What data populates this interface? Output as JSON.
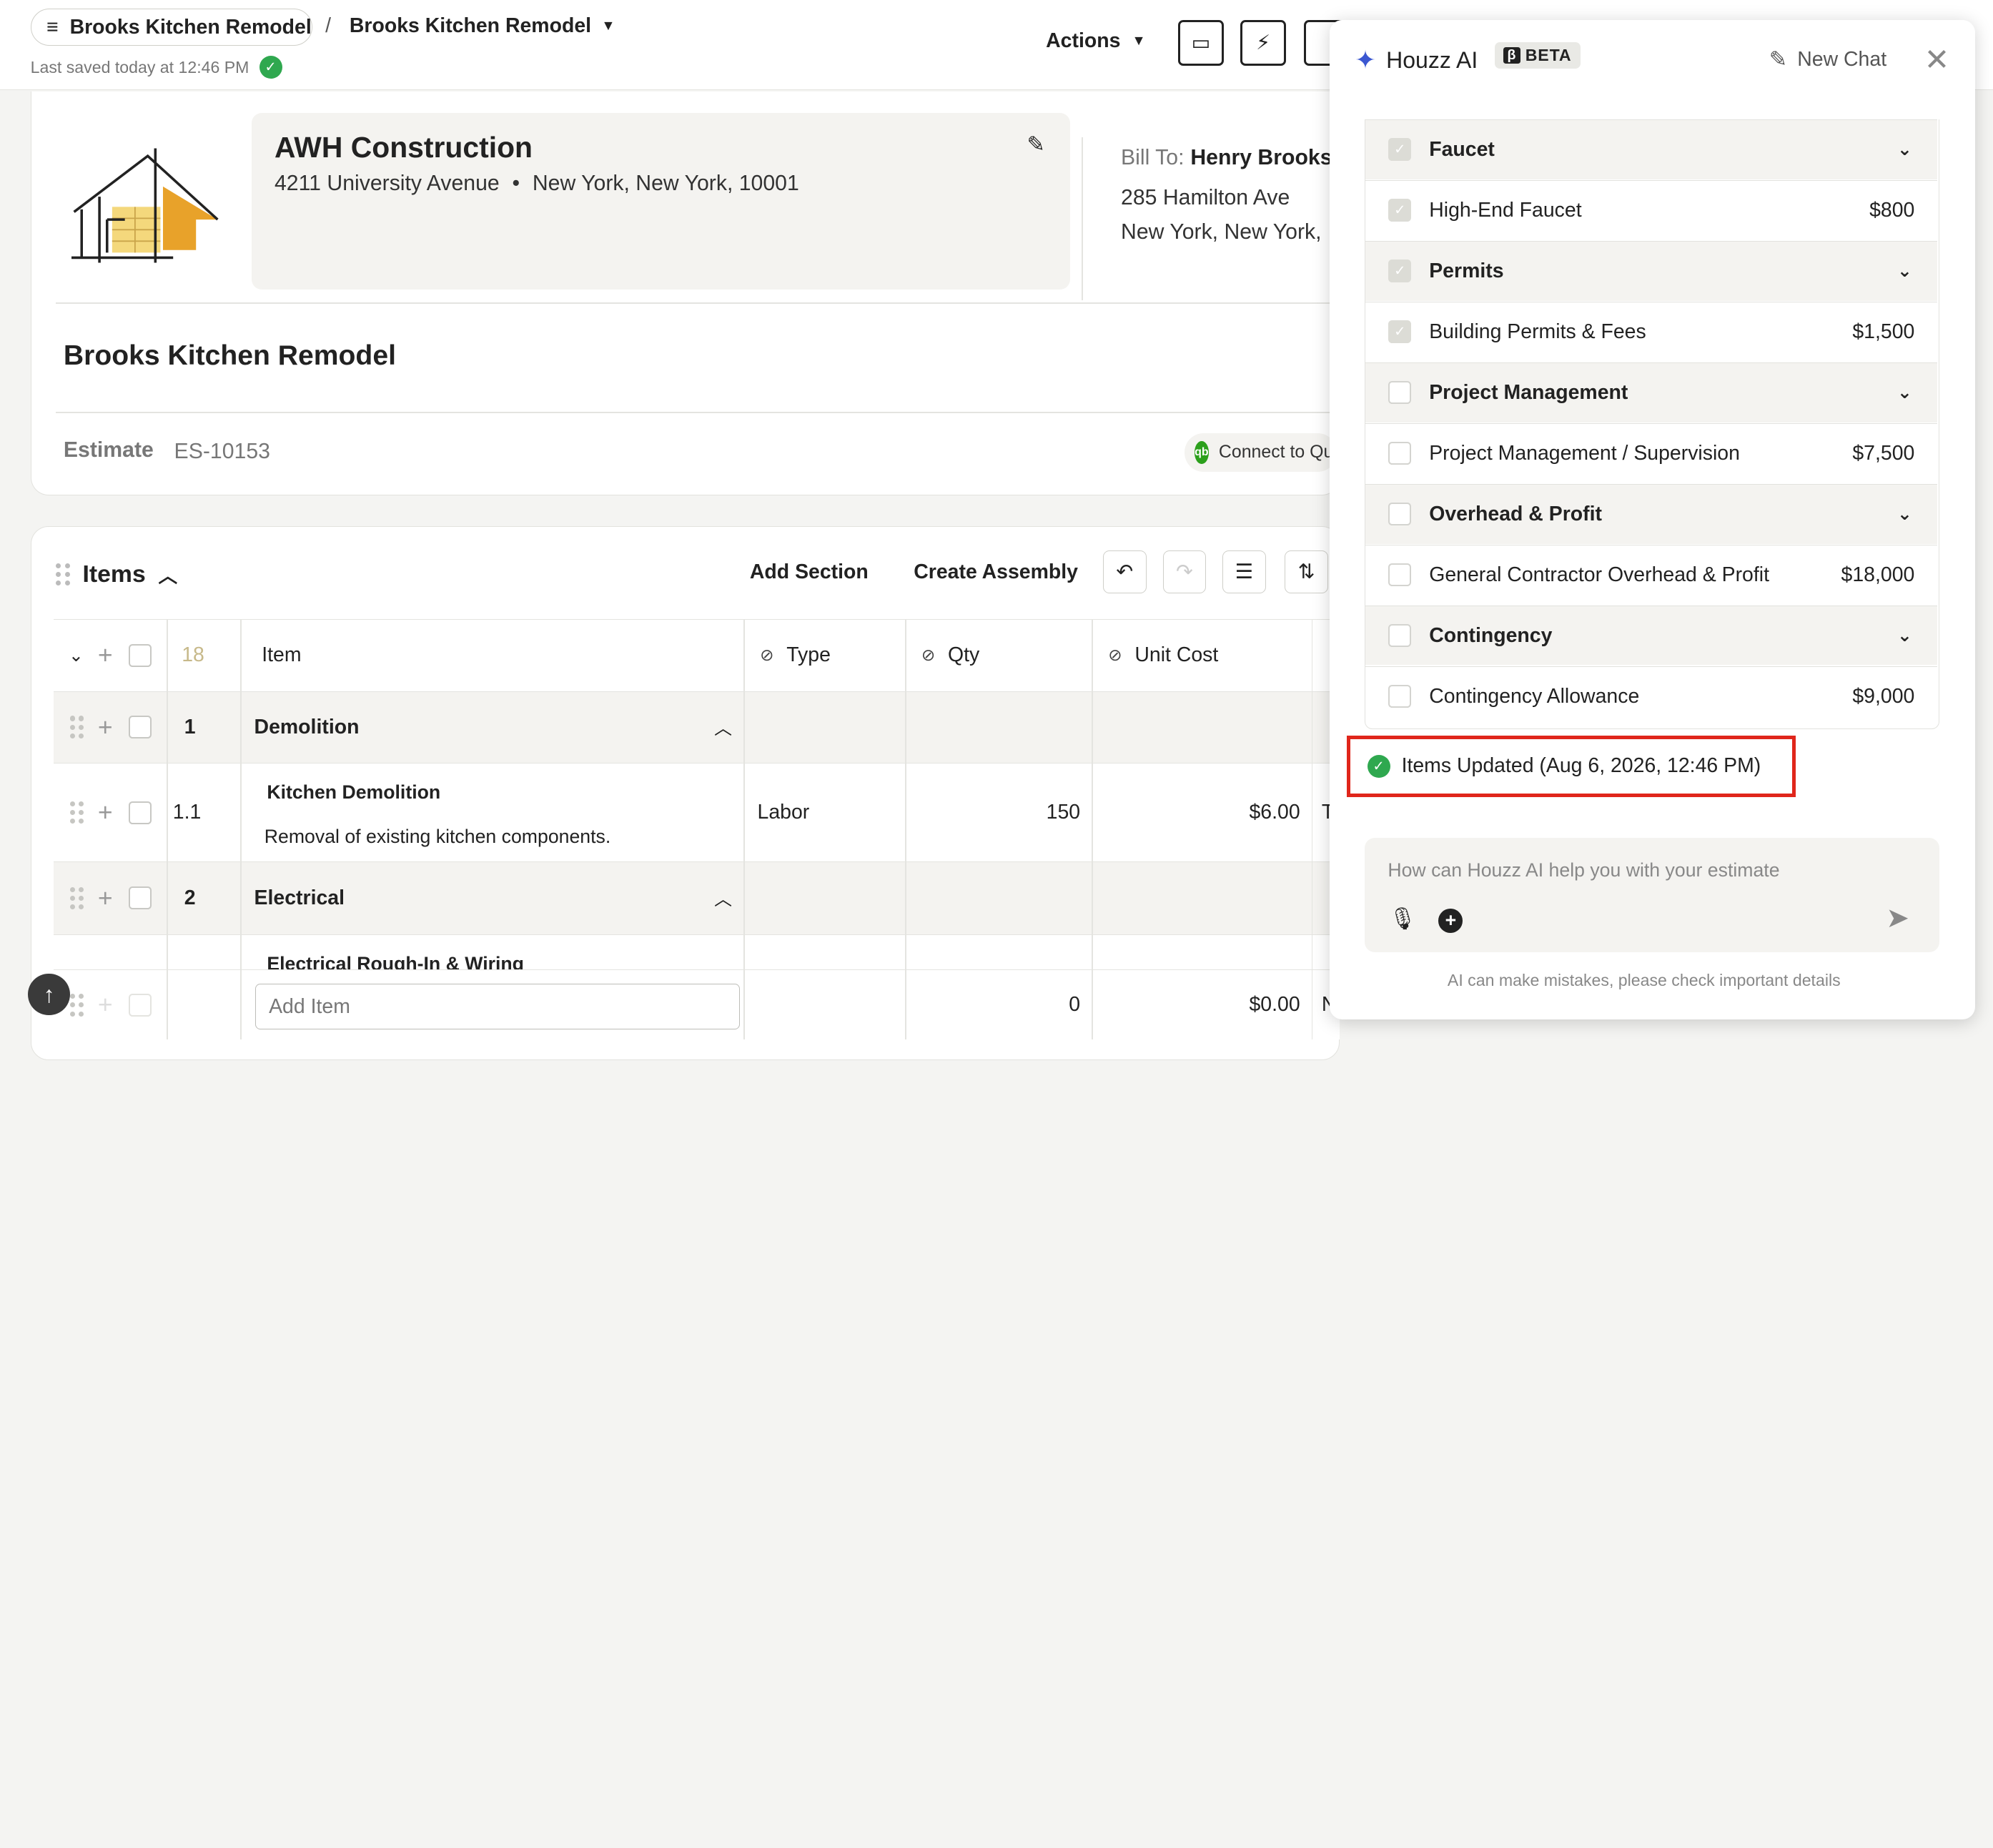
{
  "topbar": {
    "project_button": "Brooks Kitchen Remodel",
    "breadcrumb_sep": "/",
    "breadcrumb_current": "Brooks Kitchen Remodel",
    "saved_text": "Last saved today at 12:46 PM",
    "actions_label": "Actions"
  },
  "header": {
    "company_name": "AWH Construction",
    "company_street": "4211 University Avenue",
    "company_dot": "•",
    "company_city": "New York, New York, 10001",
    "bill_to_label": "Bill To:",
    "bill_to_name": "Henry Brooks",
    "bill_addr1": "285 Hamilton Ave",
    "bill_addr2": "New York, New York,",
    "project_title": "Brooks Kitchen Remodel",
    "estimate_label": "Estimate",
    "estimate_number": "ES-10153",
    "qb_label": "Connect to QuickBooks",
    "qb_icon_text": "qb"
  },
  "items": {
    "heading": "Items",
    "add_section": "Add Section",
    "create_assembly": "Create Assembly",
    "count": "18",
    "columns": {
      "item": "Item",
      "type": "Type",
      "qty": "Qty",
      "unit_cost": "Unit Cost"
    },
    "rows": [
      {
        "num": "1",
        "name": "Demolition",
        "kind": "section"
      },
      {
        "num": "1.1",
        "name": "Kitchen Demolition",
        "desc": "Removal of existing kitchen components.",
        "type": "Labor",
        "qty": "150",
        "unit_cost": "$6.00",
        "extra": "T",
        "kind": "item"
      },
      {
        "num": "2",
        "name": "Electrical",
        "kind": "section"
      },
      {
        "num": "",
        "name": "Electrical Rough-In & Wiring",
        "kind": "partial"
      }
    ],
    "add_item_placeholder": "Add Item",
    "add_row_qty": "0",
    "add_row_cost": "$0.00",
    "add_row_extra": "N"
  },
  "ai": {
    "title": "Houzz AI",
    "beta": "BETA",
    "beta_icon": "β",
    "new_chat": "New Chat",
    "list": [
      {
        "label": "Faucet",
        "group": true,
        "checked": true
      },
      {
        "label": "High-End Faucet",
        "amount": "$800",
        "checked": true
      },
      {
        "label": "Permits",
        "group": true,
        "checked": true
      },
      {
        "label": "Building Permits & Fees",
        "amount": "$1,500",
        "checked": true
      },
      {
        "label": "Project Management",
        "group": true,
        "checked": false
      },
      {
        "label": "Project Management / Supervision",
        "amount": "$7,500",
        "checked": false
      },
      {
        "label": "Overhead & Profit",
        "group": true,
        "checked": false
      },
      {
        "label": "General Contractor Overhead & Profit",
        "amount": "$18,000",
        "checked": false
      },
      {
        "label": "Contingency",
        "group": true,
        "checked": false
      },
      {
        "label": "Contingency Allowance",
        "amount": "$9,000",
        "checked": false
      }
    ],
    "status": "Items Updated (Aug 6, 2026, 12:46 PM)",
    "input_placeholder": "How can Houzz AI help you with your estimate",
    "disclaimer": "AI can make mistakes, please check important details"
  },
  "colors": {
    "status_border": "#e0261b",
    "success": "#2fa84f",
    "sparkle": "#3b57d1"
  }
}
